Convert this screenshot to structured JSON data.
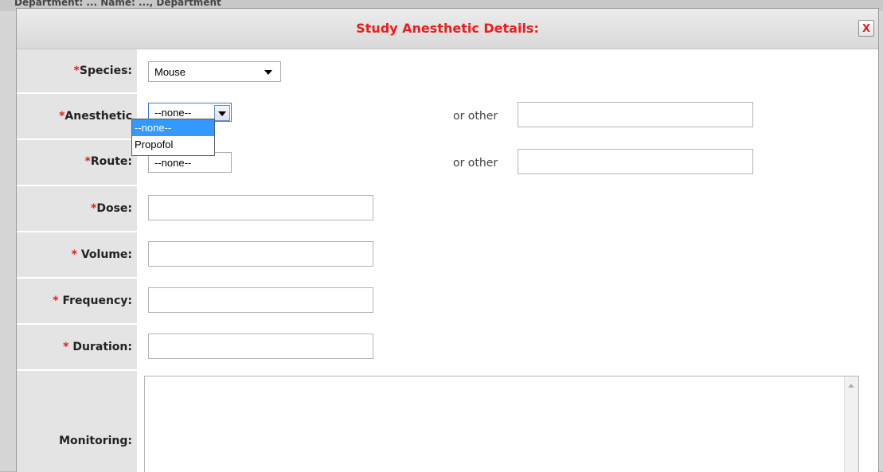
{
  "background_page": {
    "header_text": "Department: ... Name: ..., Department"
  },
  "dialog": {
    "title": "Study Anesthetic Details:",
    "close_label": "X",
    "title_color": "#ee1c1c"
  },
  "form": {
    "required_marker": "*",
    "species": {
      "label": "Species:",
      "value": "Mouse"
    },
    "anesthetic": {
      "label": "Anesthetic",
      "value": "--none--",
      "or_other_label": "or other",
      "other_value": "",
      "options": [
        "--none--",
        "Propofol"
      ],
      "highlighted_option": "--none--"
    },
    "route": {
      "label": "Route:",
      "value": "--none--",
      "or_other_label": "or other",
      "other_value": ""
    },
    "dose": {
      "label": "Dose:",
      "value": ""
    },
    "volume": {
      "label": "Volume:",
      "value": ""
    },
    "frequency": {
      "label": "Frequency:",
      "value": ""
    },
    "duration": {
      "label": "Duration:",
      "value": ""
    },
    "monitoring": {
      "label": "Monitoring:",
      "value": ""
    }
  }
}
